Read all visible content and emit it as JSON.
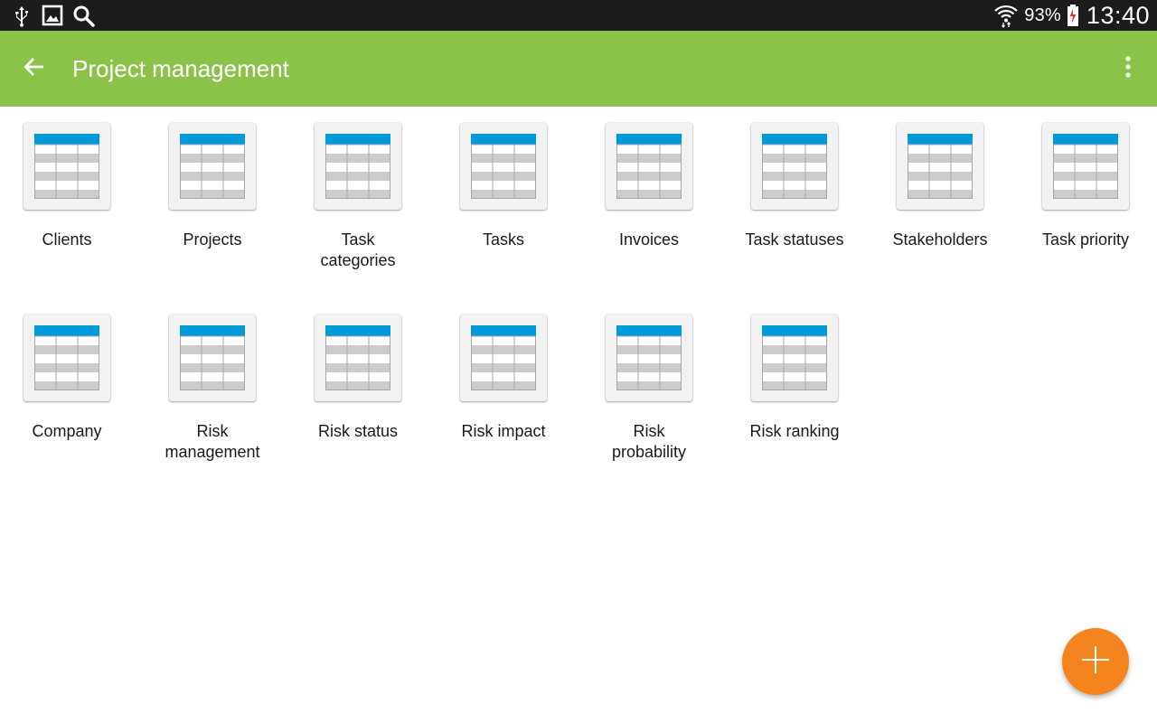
{
  "status_bar": {
    "left_icons": [
      "usb-icon",
      "image-icon",
      "search-icon"
    ],
    "right_icons": [
      "wifi-icon",
      "battery-icon"
    ],
    "battery_percent": "93%",
    "time": "13:40"
  },
  "app_bar": {
    "back_icon": "arrow-left-icon",
    "title": "Project management",
    "overflow_icon": "more-vert-icon"
  },
  "tiles": [
    {
      "label": "Clients"
    },
    {
      "label": "Projects"
    },
    {
      "label": "Task\ncategories"
    },
    {
      "label": "Tasks"
    },
    {
      "label": "Invoices"
    },
    {
      "label": "Task statuses"
    },
    {
      "label": "Stakeholders"
    },
    {
      "label": "Task priority"
    },
    {
      "label": "Company"
    },
    {
      "label": "Risk\nmanagement"
    },
    {
      "label": "Risk status"
    },
    {
      "label": "Risk impact"
    },
    {
      "label": "Risk\nprobability"
    },
    {
      "label": "Risk ranking"
    }
  ],
  "tile_icon": "table-icon",
  "fab": {
    "icon": "plus-icon"
  },
  "colors": {
    "status_bar": "#1c1c1c",
    "app_bar": "#8bc34a",
    "table_header": "#0099d9",
    "fab": "#f5841f"
  }
}
